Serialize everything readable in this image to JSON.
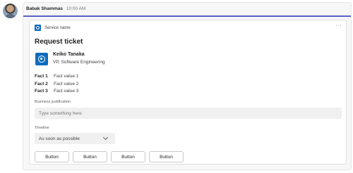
{
  "message": {
    "sender": "Babak Shammas",
    "timestamp": "10:00 AM"
  },
  "card": {
    "service_name": "Service name",
    "title": "Request ticket",
    "person": {
      "name": "Keiko Tanaka",
      "title": "VP, Software Engineering"
    },
    "facts": [
      {
        "key": "Fact 1",
        "value": "Fact value 1"
      },
      {
        "key": "Fact 2",
        "value": "Fact value 2"
      },
      {
        "key": "Fact 3",
        "value": "Fact value 3"
      }
    ],
    "justification": {
      "label": "Business justification",
      "placeholder": "Type something here"
    },
    "timeline": {
      "label": "Timeline",
      "selected": "As soon as possible"
    },
    "buttons": [
      "Button",
      "Button",
      "Button",
      "Button"
    ]
  },
  "colors": {
    "accent": "#5b5fc7",
    "brand_blue": "#0f6cbd"
  },
  "icons": {
    "more": "more-options-icon",
    "service": "service-app-icon",
    "person": "person-icon",
    "dropdown": "chevron-down-icon"
  }
}
